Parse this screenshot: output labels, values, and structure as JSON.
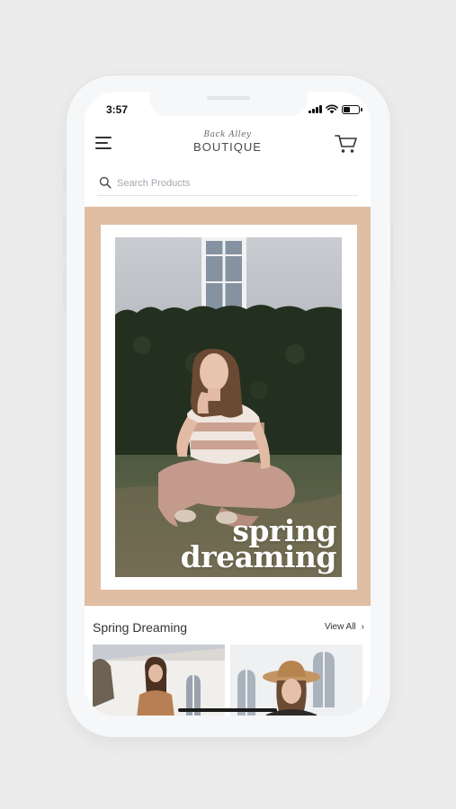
{
  "status_bar": {
    "time": "3:57",
    "battery_level": 0.45,
    "icons": [
      "signal-icon",
      "wifi-icon",
      "battery-icon"
    ]
  },
  "header": {
    "logo_script": "Back Alley",
    "logo_main": "BOUTIQUE",
    "menu_icon": "menu-icon",
    "cart_icon": "cart-icon"
  },
  "search": {
    "placeholder": "Search Products",
    "value": "",
    "icon": "search-icon"
  },
  "hero": {
    "title_line1": "spring",
    "title_line2": "dreaming",
    "frame_color": "#e0bea4"
  },
  "section": {
    "title": "Spring Dreaming",
    "view_all_label": "View All",
    "chevron": "›"
  },
  "products": [
    {
      "image": "product-photo"
    },
    {
      "image": "product-photo"
    }
  ]
}
